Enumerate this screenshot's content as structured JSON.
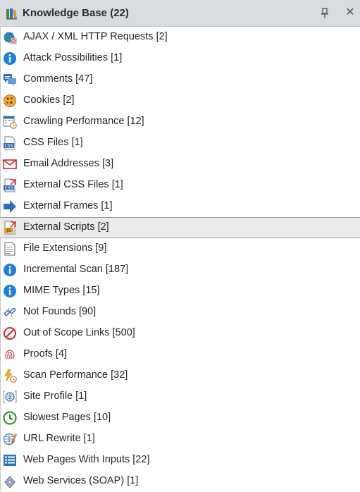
{
  "header": {
    "title": "Knowledge Base (22)",
    "close_glyph": "✕"
  },
  "items": [
    {
      "label": "AJAX / XML HTTP Requests [2]",
      "icon": "globe-ajax-icon"
    },
    {
      "label": "Attack Possibilities [1]",
      "icon": "info-icon"
    },
    {
      "label": "Comments [47]",
      "icon": "comments-icon"
    },
    {
      "label": "Cookies [2]",
      "icon": "cookie-icon"
    },
    {
      "label": "Crawling Performance [12]",
      "icon": "calendar-clock-icon"
    },
    {
      "label": "CSS Files [1]",
      "icon": "css-file-icon"
    },
    {
      "label": "Email Addresses [3]",
      "icon": "envelope-icon"
    },
    {
      "label": "External CSS Files [1]",
      "icon": "external-css-icon"
    },
    {
      "label": "External Frames [1]",
      "icon": "arrow-right-icon"
    },
    {
      "label": "External Scripts [2]",
      "icon": "external-js-icon"
    },
    {
      "label": "File Extensions [9]",
      "icon": "document-icon"
    },
    {
      "label": "Incremental Scan [187]",
      "icon": "info-icon"
    },
    {
      "label": "MIME Types [15]",
      "icon": "info-icon"
    },
    {
      "label": "Not Founds [90]",
      "icon": "broken-link-icon"
    },
    {
      "label": "Out of Scope Links [500]",
      "icon": "forbidden-link-icon"
    },
    {
      "label": "Proofs [4]",
      "icon": "fingerprint-icon"
    },
    {
      "label": "Scan Performance [32]",
      "icon": "lightning-clock-icon"
    },
    {
      "label": "Site Profile [1]",
      "icon": "site-profile-icon"
    },
    {
      "label": "Slowest Pages [10]",
      "icon": "clock-icon"
    },
    {
      "label": "URL Rewrite [1]",
      "icon": "globe-pencil-icon"
    },
    {
      "label": "Web Pages With Inputs [22]",
      "icon": "list-icon"
    },
    {
      "label": "Web Services (SOAP) [1]",
      "icon": "soap-icon"
    }
  ],
  "selected_index": 9,
  "colors": {
    "info": "#1a7fe0",
    "envelope": "#c8262a",
    "arrow": "#2d6db5",
    "clock": "#2a9d2a",
    "header_bg": "#d8dce1"
  }
}
